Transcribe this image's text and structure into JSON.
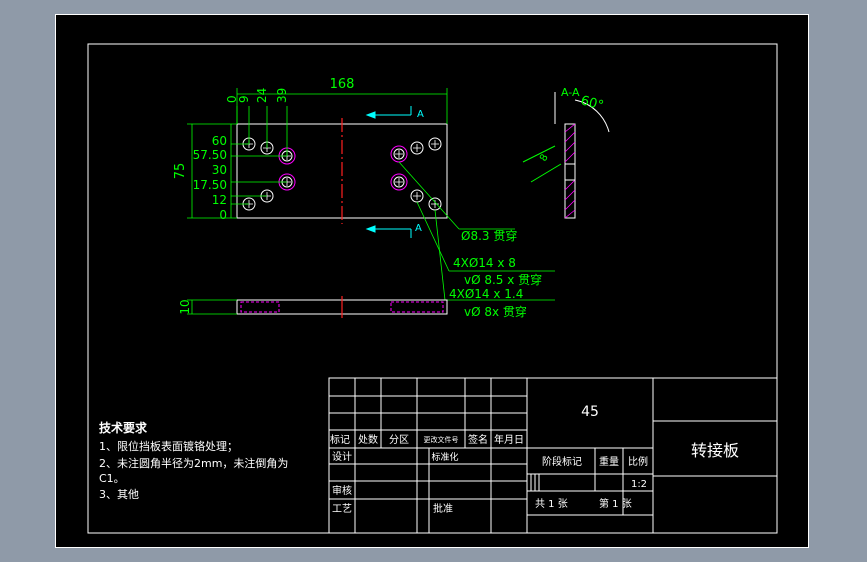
{
  "app": {
    "title": "转接板"
  },
  "drawing": {
    "part_name": "转接板",
    "material": "45",
    "scale": "1:2",
    "section_label": "A-A",
    "angle_label": "60°",
    "section_marker": "A",
    "dims": {
      "overall_length": "168",
      "height": "75",
      "thickness": "10",
      "left_ord_x": [
        "0",
        "9",
        "24",
        "39"
      ],
      "left_ord_y": [
        "60",
        "57.50",
        "30",
        "17.50",
        "12",
        "0"
      ],
      "section_dim": "8"
    },
    "callouts": {
      "hole1": "Ø8.3 贯穿",
      "hole2_line1": "4XØ14 x 8",
      "hole2_line2": "vØ 8.5 x 贯穿",
      "hole3_line1": "4XØ14 x 1.4",
      "hole3_line2": "vØ 8x 贯穿"
    }
  },
  "notes": {
    "title": "技术要求",
    "items": [
      "1、限位挡板表面镀铬处理；",
      "2、未注圆角半径为2mm，未注倒角为",
      "C1。",
      "3、其他"
    ]
  },
  "title_block": {
    "row_labels": {
      "biaoji": "标记",
      "chushu": "处数",
      "fenqu": "分区",
      "gengai": "更改文件号",
      "qianming": "签名",
      "nianyueri": "年月日"
    },
    "sheji": "设计",
    "biaozhunhua": "标准化",
    "shenhe": "审核",
    "gongyi": "工艺",
    "pizhun": "批准",
    "jieduan": "阶段标记",
    "zhongliang": "重量",
    "bili": "比例",
    "total_sheets": "共 1 张",
    "sheet_no": "第 1 张"
  },
  "colors": {
    "background": "#000000",
    "frame": "#ffffff",
    "geometry": "#ffffff",
    "dimension": "#00ff00",
    "centerline": "#ff2020",
    "hidden": "#ff00ff",
    "hole_marker": "#ff00ff",
    "arrow": "#00ffff",
    "window_bg": "#8f9aa8"
  }
}
